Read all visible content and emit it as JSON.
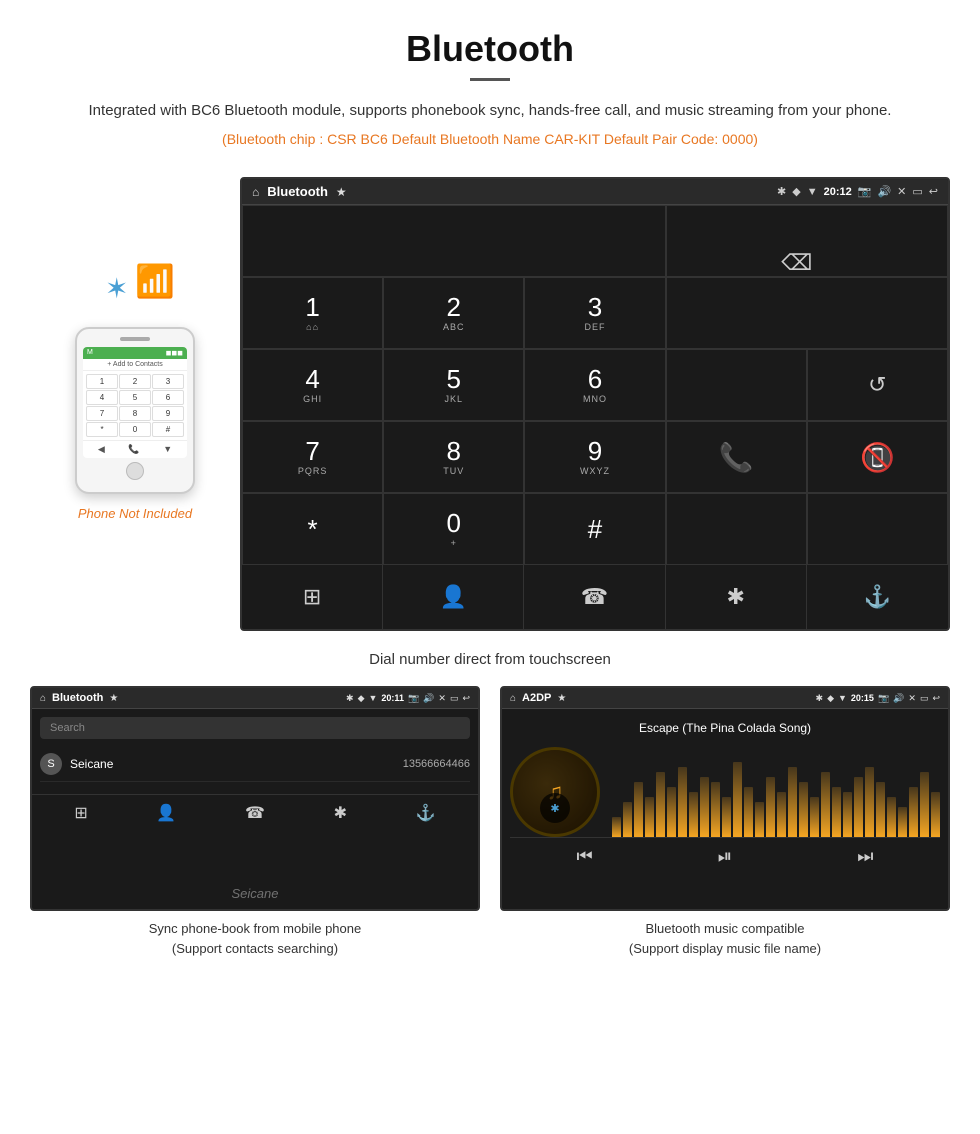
{
  "header": {
    "title": "Bluetooth",
    "description": "Integrated with BC6 Bluetooth module, supports phonebook sync, hands-free call, and music streaming from your phone.",
    "specs": "(Bluetooth chip : CSR BC6    Default Bluetooth Name CAR-KIT    Default Pair Code: 0000)"
  },
  "phone_mockup": {
    "not_included": "Phone Not Included"
  },
  "dialer_screen": {
    "title": "Bluetooth",
    "time": "20:12",
    "keys": [
      {
        "num": "1",
        "sub": "⌂⌂"
      },
      {
        "num": "2",
        "sub": "ABC"
      },
      {
        "num": "3",
        "sub": "DEF"
      },
      {
        "num": "4",
        "sub": "GHI"
      },
      {
        "num": "5",
        "sub": "JKL"
      },
      {
        "num": "6",
        "sub": "MNO"
      },
      {
        "num": "7",
        "sub": "PQRS"
      },
      {
        "num": "8",
        "sub": "TUV"
      },
      {
        "num": "9",
        "sub": "WXYZ"
      },
      {
        "num": "*",
        "sub": ""
      },
      {
        "num": "0",
        "sub": "+"
      },
      {
        "num": "#",
        "sub": ""
      }
    ],
    "caption": "Dial number direct from touchscreen"
  },
  "contacts_screen": {
    "title": "Bluetooth",
    "time": "20:11",
    "search_placeholder": "Search",
    "contact": {
      "initial": "S",
      "name": "Seicane",
      "number": "13566664466"
    },
    "caption_line1": "Sync phone-book from mobile phone",
    "caption_line2": "(Support contacts searching)"
  },
  "music_screen": {
    "title": "A2DP",
    "time": "20:15",
    "song_title": "Escape (The Pina Colada Song)",
    "caption_line1": "Bluetooth music compatible",
    "caption_line2": "(Support display music file name)"
  },
  "watermark": "Seicane",
  "vis_heights": [
    20,
    35,
    55,
    40,
    65,
    50,
    70,
    45,
    60,
    55,
    40,
    75,
    50,
    35,
    60,
    45,
    70,
    55,
    40,
    65,
    50,
    45,
    60,
    70,
    55,
    40,
    30,
    50,
    65,
    45
  ]
}
